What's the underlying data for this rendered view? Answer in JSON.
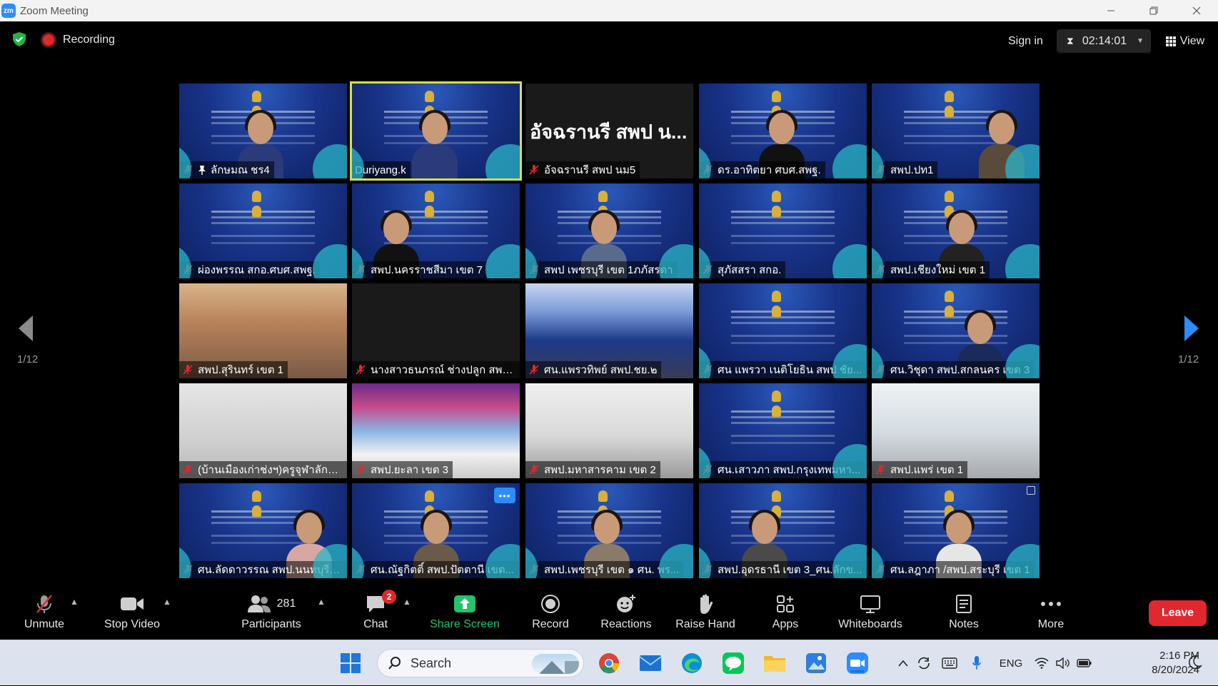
{
  "window": {
    "app_icon_text": "zm",
    "title": "Zoom Meeting"
  },
  "topbar": {
    "recording_label": "Recording",
    "sign_in_label": "Sign in",
    "timer": "02:14:01",
    "view_label": "View",
    "page_left": "1/12",
    "page_right": "1/12"
  },
  "tiles": [
    {
      "name": "ลักษมณ ชร4",
      "pinned": true
    },
    {
      "name": "Duriyang.k",
      "muted": false,
      "active": true
    },
    {
      "name": "อัจฉรานรี สพป นม5",
      "big_name": "อัจฉรานรี สพป น..."
    },
    {
      "name": "ดร.อาทิตยา ศบศ.สพฐ."
    },
    {
      "name": "สพป.ปท1"
    },
    {
      "name": "ผ่องพรรณ สกอ.ศบศ.สพฐ."
    },
    {
      "name": "สพป.นครราชสีมา เขต 7"
    },
    {
      "name": "สพป เพชรบุรี เขต 1ภภัสรดา"
    },
    {
      "name": "สุภัสสรา สกอ."
    },
    {
      "name": "สพป.เชียงใหม่ เขต 1"
    },
    {
      "name": "สพป.สุรินทร์ เขต 1"
    },
    {
      "name": "นางสาวธนภรณ์ ช่างปลูก สพป..."
    },
    {
      "name": "ศน.แพรวทิพย์ สพป.ชย.๒"
    },
    {
      "name": "ศน แพรวา เนติโยธิน สพป ชัย..."
    },
    {
      "name": "ศน.วิชุดา สพป.สกลนคร เขต 3"
    },
    {
      "name": "(บ้านเมืองเก่าช่งฯ)ครูจุฬาลักษ..."
    },
    {
      "name": "สพป.ยะลา เขต 3"
    },
    {
      "name": "สพป.มหาสารคาม เขต 2"
    },
    {
      "name": "ศน.เสาวภา สพป.กรุงเทพมหา..."
    },
    {
      "name": "สพป.แพร่ เขต 1"
    },
    {
      "name": "ศน.ลัดดาวรรณ สพป.นนทบุรี เ..."
    },
    {
      "name": "ศน.ณัฐกิตติ์ สพป.ปัตตานี เขต..."
    },
    {
      "name": "สพป.เพชรบุรี เขต ๑ ศน. พร..."
    },
    {
      "name": "สพป.อุดรธานี เขต 3_ศน.ลักข..."
    },
    {
      "name": "ศน.ลฎาภา /สพป.สระบุรี เขต 1"
    }
  ],
  "toolbar": {
    "unmute": "Unmute",
    "stop_video": "Stop Video",
    "participants": "Participants",
    "participants_count": "281",
    "chat": "Chat",
    "chat_badge": "2",
    "share_screen": "Share Screen",
    "record": "Record",
    "reactions": "Reactions",
    "raise_hand": "Raise Hand",
    "apps": "Apps",
    "whiteboards": "Whiteboards",
    "notes": "Notes",
    "more": "More",
    "leave": "Leave"
  },
  "taskbar": {
    "search_label": "Search",
    "language": "ENG",
    "time": "2:16 PM",
    "date": "8/20/2024"
  },
  "colors": {
    "accent_blue": "#2d8cff",
    "leave_red": "#e0282e",
    "share_green": "#23c26b",
    "active_speaker": "#d7e04a",
    "mic_off_red": "#e0282e"
  }
}
